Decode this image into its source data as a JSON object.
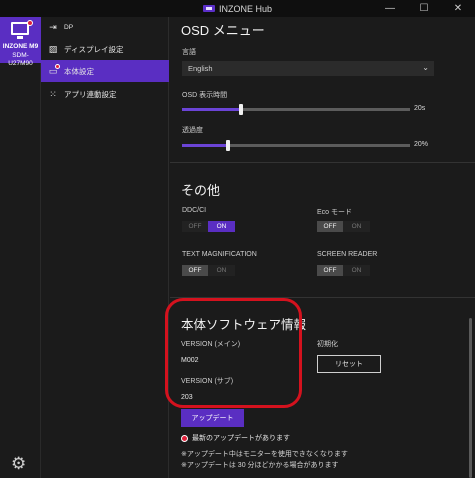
{
  "window": {
    "title": "INZONE Hub",
    "minimize": "—",
    "maximize": "☐",
    "close": "✕"
  },
  "device": {
    "name": "INZONE M9",
    "model": "SDM-U27M90"
  },
  "nav": {
    "input_label": "DP",
    "items": [
      {
        "label": "ディスプレイ設定",
        "icon": "image-icon"
      },
      {
        "label": "本体設定",
        "icon": "monitor-settings-icon"
      },
      {
        "label": "アプリ連動設定",
        "icon": "grid-icon"
      }
    ]
  },
  "osd": {
    "title": "OSD メニュー",
    "language_label": "言語",
    "language_value": "English",
    "display_time_label": "OSD 表示時間",
    "display_time_value": "20s",
    "display_time_fraction": 0.26,
    "transparency_label": "透過度",
    "transparency_value": "20%",
    "transparency_fraction": 0.2
  },
  "other": {
    "title": "その他",
    "ddc_label": "DDC/CI",
    "eco_label": "Eco モード",
    "text_mag_label": "TEXT MAGNIFICATION",
    "screen_reader_label": "SCREEN READER",
    "off": "OFF",
    "on": "ON"
  },
  "software": {
    "title": "本体ソフトウェア情報",
    "version_main_label": "VERSION (メイン)",
    "version_main_value": "M002",
    "version_sub_label": "VERSION (サブ)",
    "version_sub_value": "203",
    "reset_title": "初期化",
    "reset_button": "リセット",
    "update_button": "アップデート",
    "update_available": "最新のアップデートがあります",
    "note1": "※アップデート中はモニターを使用できなくなります",
    "note2": "※アップデートは 30 分ほどかかる場合があります"
  },
  "colors": {
    "accent": "#5a2ec2",
    "alert": "#e0203a",
    "highlight": "#d4121e"
  }
}
